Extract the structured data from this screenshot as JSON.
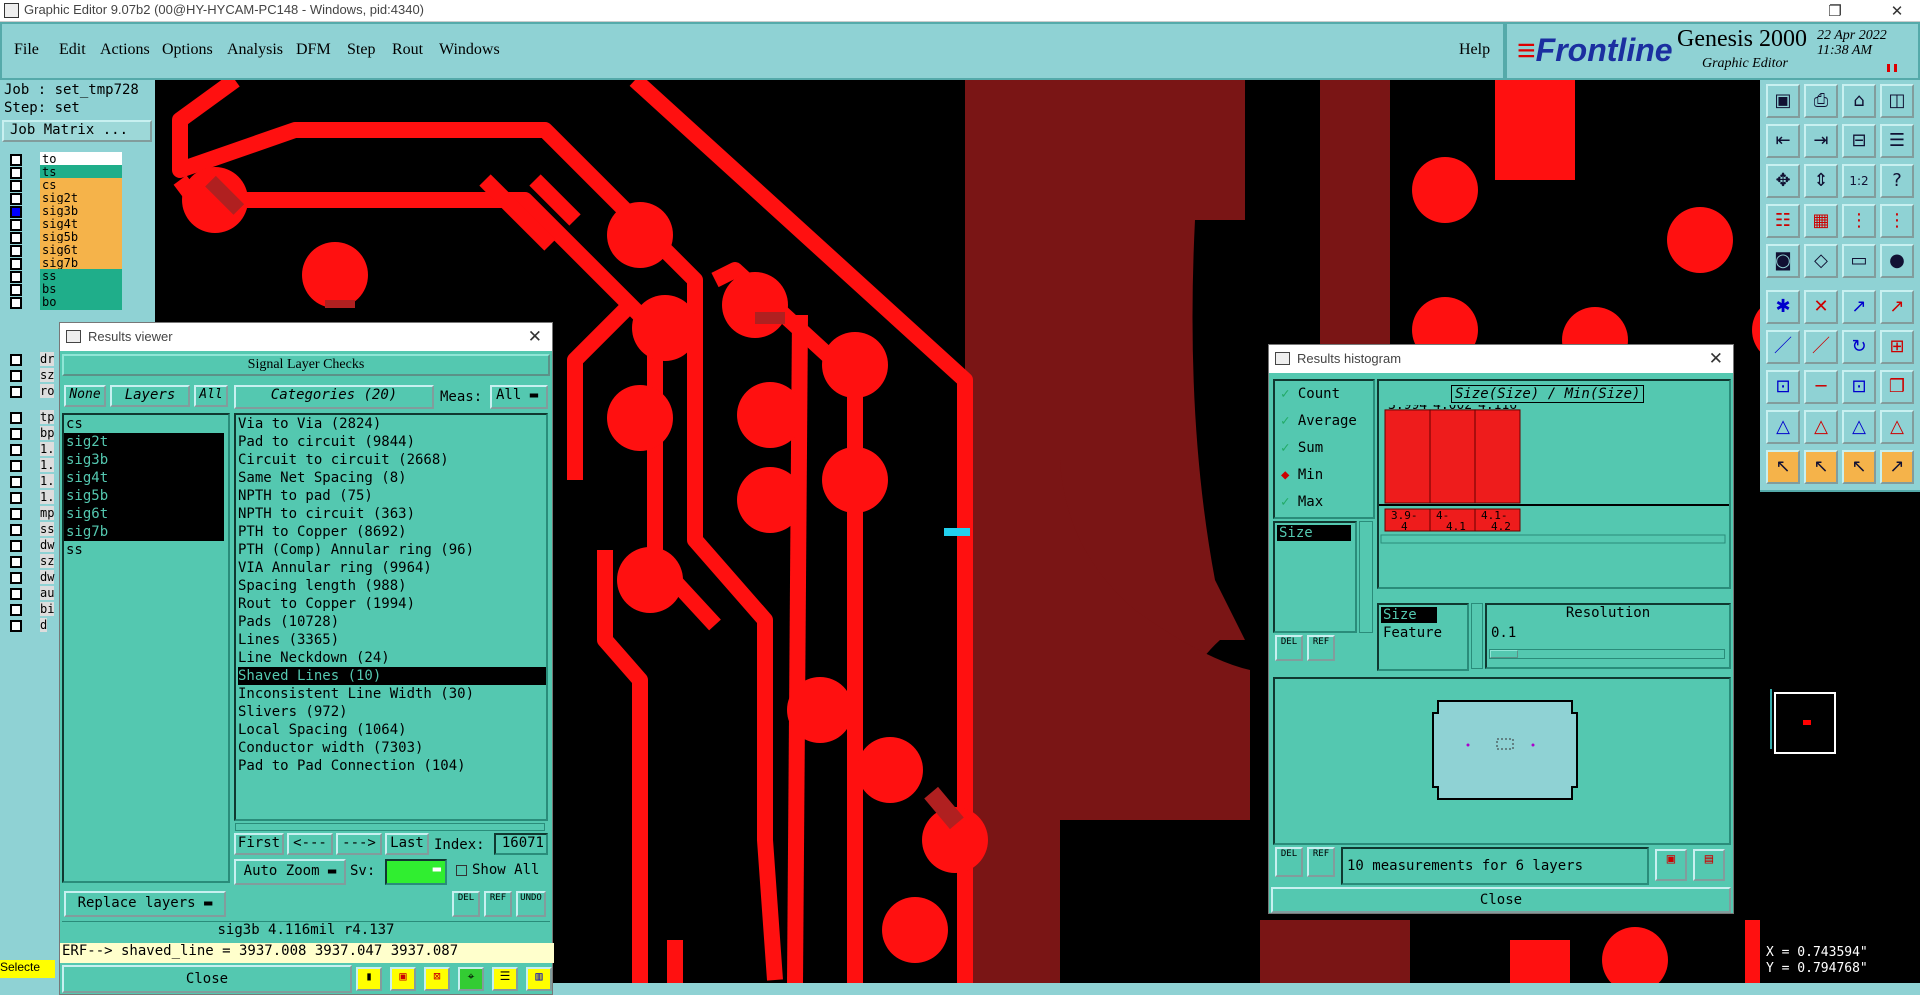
{
  "window": {
    "title": "Graphic Editor 9.07b2 (00@HY-HYCAM-PC148 - Windows, pid:4340)"
  },
  "menu": [
    "File",
    "Edit",
    "Actions",
    "Options",
    "Analysis",
    "DFM",
    "Step",
    "Rout",
    "Windows"
  ],
  "help": "Help",
  "brand": {
    "logo_main": "Frontline",
    "product": "Genesis 2000",
    "subtitle": "Graphic Editor",
    "date": "22 Apr 2022",
    "time": "11:38 AM"
  },
  "left": {
    "job": "Job : set_tmp728",
    "step": "Step: set",
    "job_matrix": "Job Matrix ...",
    "layers": [
      "to",
      "ts",
      "cs",
      "sig2t",
      "sig3b",
      "sig4t",
      "sig5b",
      "sig6t",
      "sig7b",
      "ss",
      "bs",
      "bo"
    ],
    "layers2": [
      "dr",
      "sz",
      "ro"
    ],
    "layers3": [
      "tp",
      "bp",
      "1.",
      "1.",
      "1.",
      "1.",
      "mp",
      "ss",
      "dw",
      "sz",
      "dw",
      "au",
      "bi",
      "d"
    ],
    "select": "Selecte"
  },
  "results_viewer": {
    "title": "Results viewer",
    "header": "Signal Layer Checks",
    "none": "None",
    "layers": "Layers",
    "all": "All",
    "categories": "Categories (20)",
    "meas_label": "Meas:",
    "meas_value": "All",
    "layer_list": [
      "cs",
      "sig2t",
      "sig3b",
      "sig4t",
      "sig5b",
      "sig6t",
      "sig7b",
      "ss"
    ],
    "selected_layers": [
      1,
      2,
      3,
      4,
      5,
      6
    ],
    "categories_list": [
      "Via to Via (2824)",
      "Pad to circuit (9844)",
      "Circuit to circuit (2668)",
      "Same Net Spacing (8)",
      "NPTH to pad (75)",
      "NPTH to circuit (363)",
      "PTH to Copper (8692)",
      "PTH (Comp) Annular ring (96)",
      "VIA Annular ring (9964)",
      "Spacing length (988)",
      "Rout to Copper (1994)",
      "Pads (10728)",
      "Lines (3365)",
      "Line Neckdown (24)",
      "Shaved Lines (10)",
      "Inconsistent Line Width (30)",
      "Slivers (972)",
      "Local Spacing (1064)",
      "Conductor width (7303)",
      "Pad to Pad Connection (104)"
    ],
    "selected_category": 14,
    "first": "First",
    "prev": "<---",
    "next": "--->",
    "last": "Last",
    "index_label": "Index:",
    "index_value": "16071",
    "auto_zoom": "Auto Zoom",
    "sv": "Sv:",
    "show_all": "Show All",
    "replace_layers": "Replace layers",
    "info": "sig3b 4.116mil  r4.137",
    "erf": "ERF--> shaved_line = 3937.008 3937.047 3937.087",
    "close": "Close",
    "small_buttons": [
      "DEL",
      "REF",
      "UNDO"
    ]
  },
  "histogram": {
    "title": "Results histogram",
    "options": [
      "Count",
      "Average",
      "Sum",
      "Min",
      "Max"
    ],
    "selected_option": "Min",
    "chart_title": "Size(Size) / Min(Size)",
    "list_item": "Size",
    "size_label": "Size",
    "feature_label": "Feature",
    "resolution_label": "Resolution",
    "resolution_value": "0.1",
    "measurements": "10 measurements for 6 layers",
    "close": "Close",
    "small_buttons": [
      "DEL",
      "REF"
    ]
  },
  "chart_data": {
    "type": "bar",
    "categories": [
      "3.9-4",
      "4-4.1",
      "4.1-4.2"
    ],
    "values": [
      3.994,
      4.002,
      4.116
    ],
    "title": "Size(Size) / Min(Size)"
  },
  "coords": {
    "x": "X = 0.743594\"",
    "y": "Y = 0.794768\""
  },
  "colors": {
    "panel": "#8fd2d4",
    "window": "#54c8b0",
    "copper": "#ff0000",
    "plane": "#7a1515"
  }
}
